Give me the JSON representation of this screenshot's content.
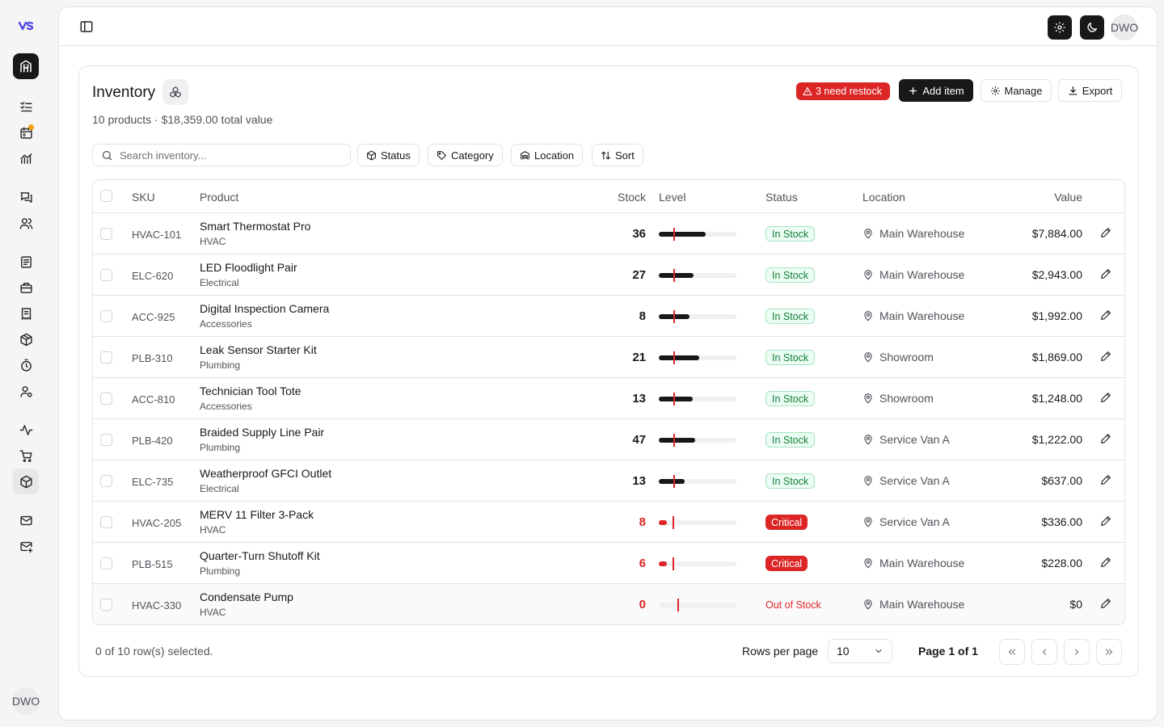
{
  "app": {
    "logo_text": "VS",
    "user_initials": "DWO",
    "colors": {
      "accent": "#18181b",
      "danger": "#dc2626",
      "success": "#15803d",
      "warning_dot": "#f59e0b"
    }
  },
  "rail": {
    "items": [
      {
        "icon": "building-icon",
        "active": true
      },
      {
        "icon": "list-check-icon"
      },
      {
        "icon": "calendar-icon",
        "has_notification": true
      },
      {
        "icon": "chart-icon"
      },
      {
        "icon": "messages-icon"
      },
      {
        "icon": "users-icon"
      },
      {
        "icon": "document-list-icon"
      },
      {
        "icon": "briefcase-icon"
      },
      {
        "icon": "receipt-icon"
      },
      {
        "icon": "package-icon"
      },
      {
        "icon": "stopwatch-icon"
      },
      {
        "icon": "user-cog-icon"
      },
      {
        "icon": "activity-icon"
      },
      {
        "icon": "cart-icon"
      },
      {
        "icon": "box-icon",
        "highlighted": true
      },
      {
        "icon": "mail-icon"
      },
      {
        "icon": "mail-plus-icon"
      }
    ]
  },
  "inventory": {
    "title": "Inventory",
    "subtitle": "10 products · $18,359.00 total value",
    "restock_alert": "3 need restock",
    "buttons": {
      "add": "Add item",
      "manage": "Manage",
      "export": "Export"
    },
    "search_placeholder": "Search inventory...",
    "filters": [
      "Status",
      "Category",
      "Location",
      "Sort"
    ],
    "columns": [
      "SKU",
      "Product",
      "Stock",
      "Level",
      "Status",
      "Location",
      "Value"
    ],
    "rows": [
      {
        "sku": "HVAC-101",
        "product": "Smart Thermostat Pro",
        "category": "HVAC",
        "stock": "36",
        "level": 0.6,
        "status": "In Stock",
        "status_kind": "ok",
        "location": "Main Warehouse",
        "value": "$7,884.00"
      },
      {
        "sku": "ELC-620",
        "product": "LED Floodlight Pair",
        "category": "Electrical",
        "stock": "27",
        "level": 0.45,
        "status": "In Stock",
        "status_kind": "ok",
        "location": "Main Warehouse",
        "value": "$2,943.00"
      },
      {
        "sku": "ACC-925",
        "product": "Digital Inspection Camera",
        "category": "Accessories",
        "stock": "8",
        "level": 0.4,
        "status": "In Stock",
        "status_kind": "ok",
        "location": "Main Warehouse",
        "value": "$1,992.00"
      },
      {
        "sku": "PLB-310",
        "product": "Leak Sensor Starter Kit",
        "category": "Plumbing",
        "stock": "21",
        "level": 0.52,
        "status": "In Stock",
        "status_kind": "ok",
        "location": "Showroom",
        "value": "$1,869.00"
      },
      {
        "sku": "ACC-810",
        "product": "Technician Tool Tote",
        "category": "Accessories",
        "stock": "13",
        "level": 0.44,
        "status": "In Stock",
        "status_kind": "ok",
        "location": "Showroom",
        "value": "$1,248.00"
      },
      {
        "sku": "PLB-420",
        "product": "Braided Supply Line Pair",
        "category": "Plumbing",
        "stock": "47",
        "level": 0.47,
        "status": "In Stock",
        "status_kind": "ok",
        "location": "Service Van A",
        "value": "$1,222.00"
      },
      {
        "sku": "ELC-735",
        "product": "Weatherproof GFCI Outlet",
        "category": "Electrical",
        "stock": "13",
        "level": 0.33,
        "status": "In Stock",
        "status_kind": "ok",
        "location": "Service Van A",
        "value": "$637.00"
      },
      {
        "sku": "HVAC-205",
        "product": "MERV 11 Filter 3-Pack",
        "category": "HVAC",
        "stock": "8",
        "level": 0.1,
        "status": "Critical",
        "status_kind": "crit",
        "location": "Service Van A",
        "value": "$336.00"
      },
      {
        "sku": "PLB-515",
        "product": "Quarter-Turn Shutoff Kit",
        "category": "Plumbing",
        "stock": "6",
        "level": 0.1,
        "status": "Critical",
        "status_kind": "crit",
        "location": "Main Warehouse",
        "value": "$228.00"
      },
      {
        "sku": "HVAC-330",
        "product": "Condensate Pump",
        "category": "HVAC",
        "stock": "0",
        "level": 0,
        "status": "Out of Stock",
        "status_kind": "out",
        "location": "Main Warehouse",
        "value": "$0"
      }
    ],
    "footer": {
      "selected": "0 of 10 row(s) selected.",
      "rows_per_page_label": "Rows per page",
      "rows_per_page_value": "10",
      "page_info": "Page 1 of 1"
    }
  }
}
